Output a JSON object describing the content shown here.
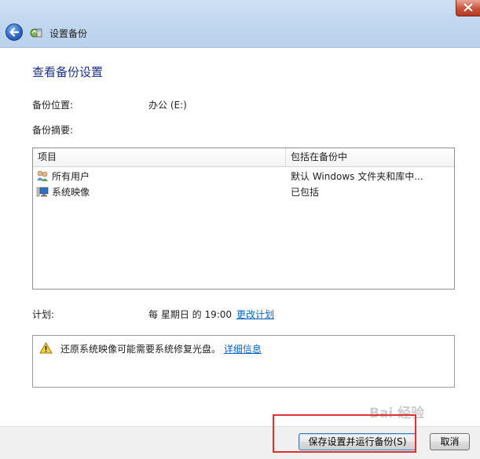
{
  "window": {
    "title": "设置备份"
  },
  "page": {
    "heading": "查看备份设置",
    "location_label": "备份位置:",
    "location_value": "办公 (E:)",
    "summary_label": "备份摘要:"
  },
  "table": {
    "columns": [
      "项目",
      "包括在备份中"
    ],
    "rows": [
      {
        "item": "所有用户",
        "icon": "users-icon",
        "included": "默认 Windows 文件夹和库中..."
      },
      {
        "item": "系统映像",
        "icon": "system-image-icon",
        "included": "已包括"
      }
    ]
  },
  "schedule": {
    "label": "计划:",
    "value": "每 星期日 的 19:00",
    "change_link": "更改计划"
  },
  "warning": {
    "icon": "warning-icon",
    "text": "还原系统映像可能需要系统修复光盘。",
    "link": "详细信息"
  },
  "buttons": {
    "save_run": "保存设置并运行备份(S)",
    "cancel": "取消"
  },
  "watermark": "Bai 经验"
}
